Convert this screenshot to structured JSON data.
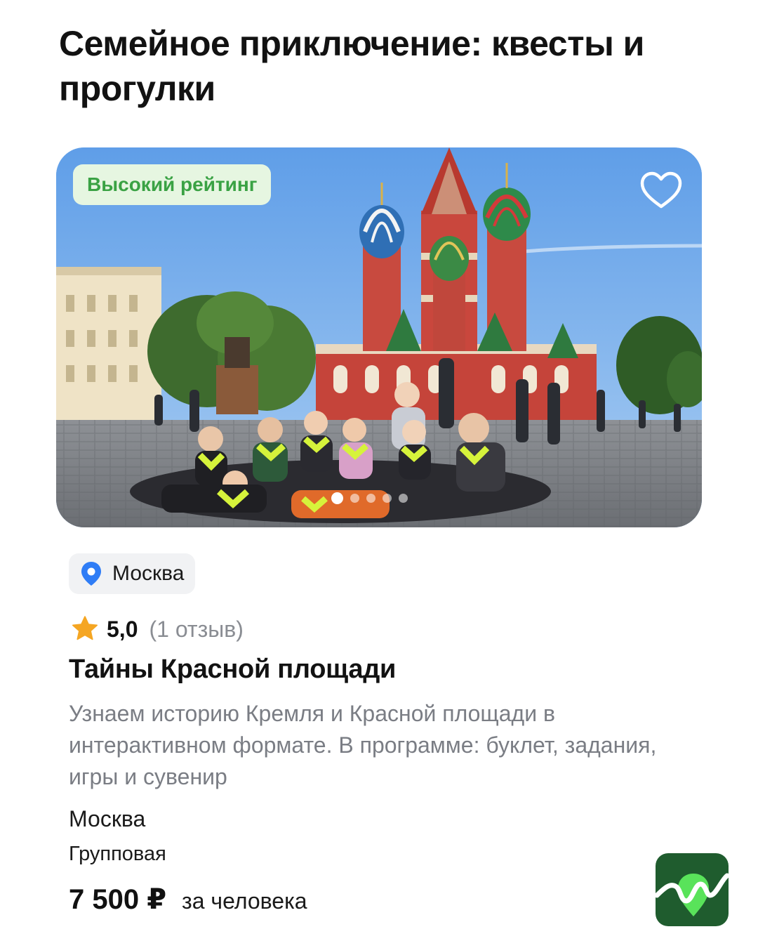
{
  "page": {
    "title": "Семейное приключение: квесты и прогулки"
  },
  "card": {
    "badge": "Высокий рейтинг",
    "favorite_icon": "heart-outline-icon",
    "gallery": {
      "pages": 5,
      "active": 0
    },
    "location_chip": {
      "icon": "map-pin-icon",
      "label": "Москва"
    },
    "rating": {
      "icon": "star-icon",
      "value": "5,0",
      "reviews": "(1 отзыв)"
    },
    "title": "Тайны Красной площади",
    "description": "Узнаем историю Кремля и Красной площади в интерактивном формате. В программе: буклет, задания, игры и сувенир",
    "city": "Москва",
    "format": "Групповая",
    "price": "7 500 ₽",
    "price_unit": "за человека"
  },
  "colors": {
    "badge_bg": "#e6f6e1",
    "badge_text": "#3aa244",
    "pin": "#2f7df6",
    "star": "#f5a623",
    "logo": "#1f5c2e"
  },
  "brand_logo": "brand-logo-icon"
}
